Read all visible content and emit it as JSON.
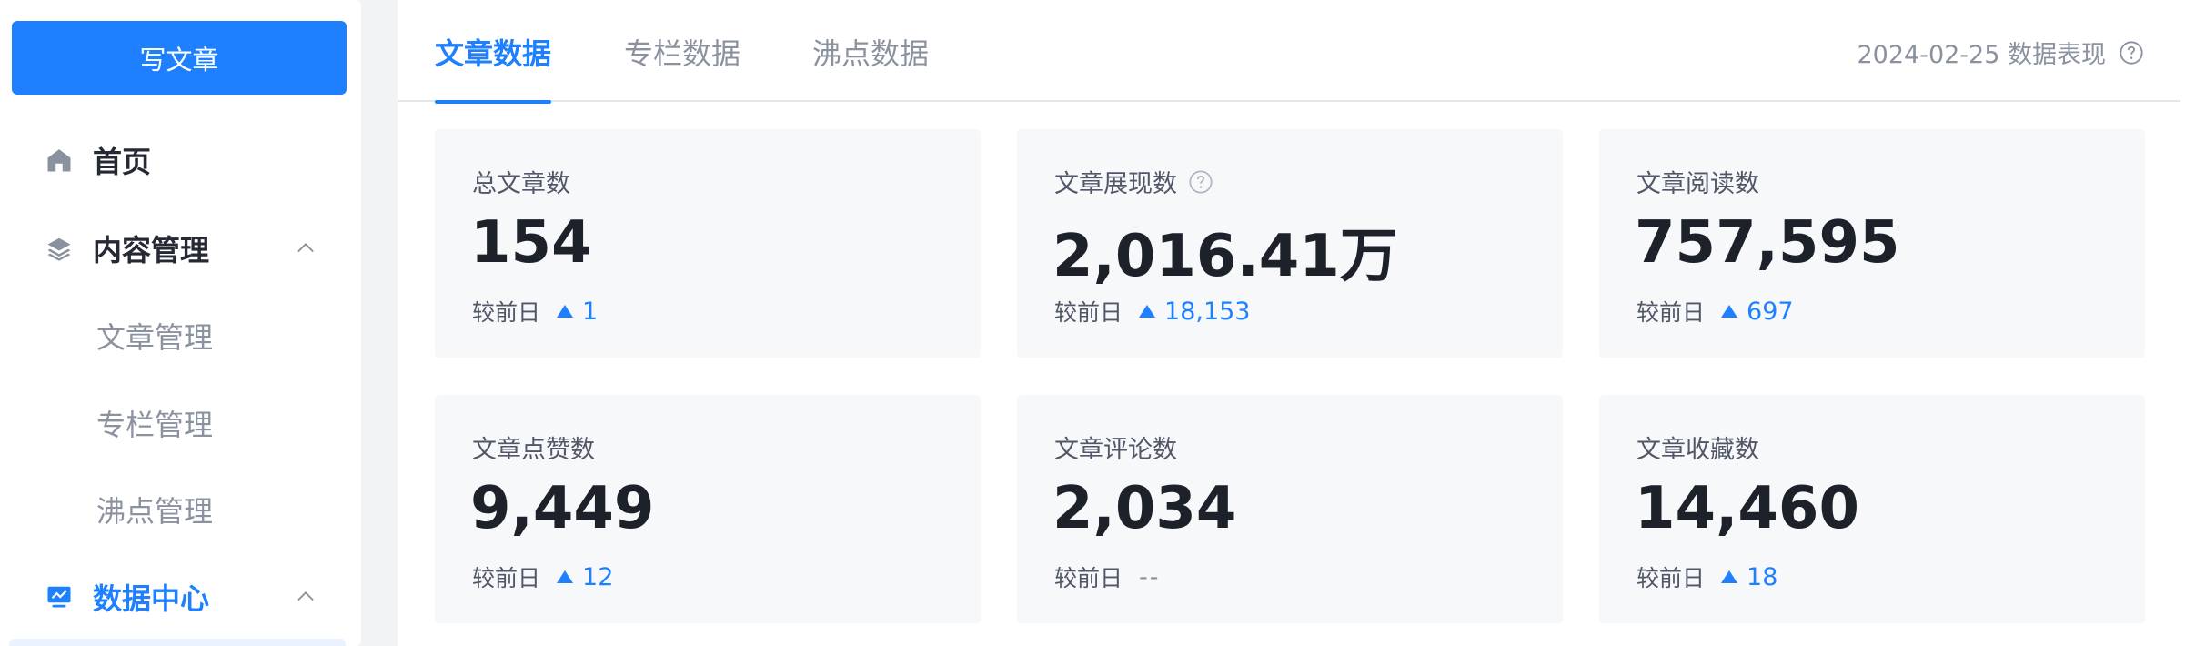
{
  "sidebar": {
    "write_button": "写文章",
    "home": {
      "label": "首页",
      "icon": "home-icon"
    },
    "content": {
      "label": "内容管理",
      "icon": "layers-icon",
      "children": [
        "文章管理",
        "专栏管理",
        "沸点管理"
      ]
    },
    "data_center": {
      "label": "数据中心",
      "icon": "chart-monitor-icon"
    }
  },
  "tabs": [
    "文章数据",
    "专栏数据",
    "沸点数据"
  ],
  "date_info": "2024-02-25 数据表现",
  "compare_label": "较前日",
  "cards": [
    {
      "title": "总文章数",
      "value": "154",
      "delta": "1",
      "has_help": false
    },
    {
      "title": "文章展现数",
      "value": "2,016.41万",
      "delta": "18,153",
      "has_help": true
    },
    {
      "title": "文章阅读数",
      "value": "757,595",
      "delta": "697",
      "has_help": false
    },
    {
      "title": "文章点赞数",
      "value": "9,449",
      "delta": "12",
      "has_help": false
    },
    {
      "title": "文章评论数",
      "value": "2,034",
      "delta": "--",
      "has_help": false
    },
    {
      "title": "文章收藏数",
      "value": "14,460",
      "delta": "18",
      "has_help": false
    }
  ],
  "colors": {
    "accent": "#1e80ff",
    "card_bg": "#f7f8fa",
    "muted": "#8a919f"
  }
}
